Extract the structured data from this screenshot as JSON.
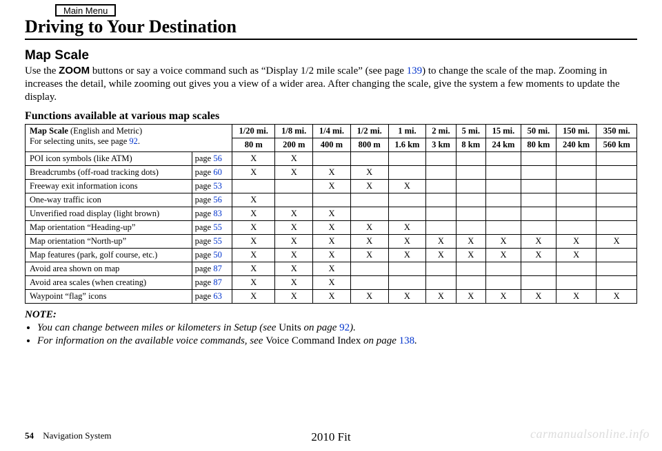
{
  "menu_button": "Main Menu",
  "page_title": "Driving to Your Destination",
  "section_heading": "Map Scale",
  "body_prefix": "Use the ",
  "body_zoom": "ZOOM",
  "body_after_zoom": " buttons or say a voice command such as “Display 1/2 mile scale” (see page ",
  "body_link1": "139",
  "body_after_link1": ") to change the scale of the map. Zooming in increases the detail, while zooming out gives you a view of a wider area. After changing the scale, give the system a few moments to update the display.",
  "table_caption": "Functions available at various map scales",
  "header_cell_strong": "Map Scale",
  "header_cell_rest": " (English and Metric)",
  "header_cell_line2_pre": "For selecting units, see page ",
  "header_cell_line2_link": "92",
  "header_cell_line2_post": ".",
  "scale_columns_english": [
    "1/20 mi.",
    "1/8 mi.",
    "1/4 mi.",
    "1/2 mi.",
    "1 mi.",
    "2 mi.",
    "5 mi.",
    "15 mi.",
    "50 mi.",
    "150 mi.",
    "350 mi."
  ],
  "scale_columns_metric": [
    "80 m",
    "200 m",
    "400 m",
    "800 m",
    "1.6 km",
    "3 km",
    "8 km",
    "24 km",
    "80 km",
    "240 km",
    "560 km"
  ],
  "chart_data": {
    "type": "table",
    "columns_english": [
      "1/20 mi.",
      "1/8 mi.",
      "1/4 mi.",
      "1/2 mi.",
      "1 mi.",
      "2 mi.",
      "5 mi.",
      "15 mi.",
      "50 mi.",
      "150 mi.",
      "350 mi."
    ],
    "columns_metric": [
      "80 m",
      "200 m",
      "400 m",
      "800 m",
      "1.6 km",
      "3 km",
      "8 km",
      "24 km",
      "80 km",
      "240 km",
      "560 km"
    ],
    "rows": [
      {
        "feature": "POI icon symbols (like ATM)",
        "page": "56",
        "marks": [
          "X",
          "X",
          "",
          "",
          "",
          "",
          "",
          "",
          "",
          "",
          ""
        ]
      },
      {
        "feature": "Breadcrumbs (off-road tracking dots)",
        "page": "60",
        "marks": [
          "X",
          "X",
          "X",
          "X",
          "",
          "",
          "",
          "",
          "",
          "",
          ""
        ]
      },
      {
        "feature": "Freeway exit information icons",
        "page": "53",
        "marks": [
          "",
          "",
          "X",
          "X",
          "X",
          "",
          "",
          "",
          "",
          "",
          ""
        ]
      },
      {
        "feature": "One-way traffic icon",
        "page": "56",
        "marks": [
          "X",
          "",
          "",
          "",
          "",
          "",
          "",
          "",
          "",
          "",
          ""
        ]
      },
      {
        "feature": "Unverified road display (light brown)",
        "page": "83",
        "marks": [
          "X",
          "X",
          "X",
          "",
          "",
          "",
          "",
          "",
          "",
          "",
          ""
        ]
      },
      {
        "feature": "Map orientation “Heading-up”",
        "page": "55",
        "marks": [
          "X",
          "X",
          "X",
          "X",
          "X",
          "",
          "",
          "",
          "",
          "",
          ""
        ]
      },
      {
        "feature": "Map orientation “North-up”",
        "page": "55",
        "marks": [
          "X",
          "X",
          "X",
          "X",
          "X",
          "X",
          "X",
          "X",
          "X",
          "X",
          "X"
        ]
      },
      {
        "feature": "Map features (park, golf course, etc.)",
        "page": "50",
        "marks": [
          "X",
          "X",
          "X",
          "X",
          "X",
          "X",
          "X",
          "X",
          "X",
          "X",
          ""
        ]
      },
      {
        "feature": "Avoid area shown on map",
        "page": "87",
        "marks": [
          "X",
          "X",
          "X",
          "",
          "",
          "",
          "",
          "",
          "",
          "",
          ""
        ]
      },
      {
        "feature": "Avoid area scales (when creating)",
        "page": "87",
        "marks": [
          "X",
          "X",
          "X",
          "",
          "",
          "",
          "",
          "",
          "",
          "",
          ""
        ]
      },
      {
        "feature": "Waypoint “flag” icons",
        "page": "63",
        "marks": [
          "X",
          "X",
          "X",
          "X",
          "X",
          "X",
          "X",
          "X",
          "X",
          "X",
          "X"
        ]
      }
    ]
  },
  "page_word": "page ",
  "note_label": "NOTE:",
  "note1_pre": "You can change between miles or kilometers in Setup (see ",
  "note1_roman": "Units",
  "note1_mid": " on page ",
  "note1_link": "92",
  "note1_post": ").",
  "note2_pre": "For information on the available voice commands, see ",
  "note2_roman": "Voice Command Index",
  "note2_mid": " on page ",
  "note2_link": "138",
  "note2_post": ".",
  "footer_pagenum": "54",
  "footer_system": "Navigation System",
  "footer_model": "2010 Fit",
  "watermark": "carmanualsonline.info"
}
